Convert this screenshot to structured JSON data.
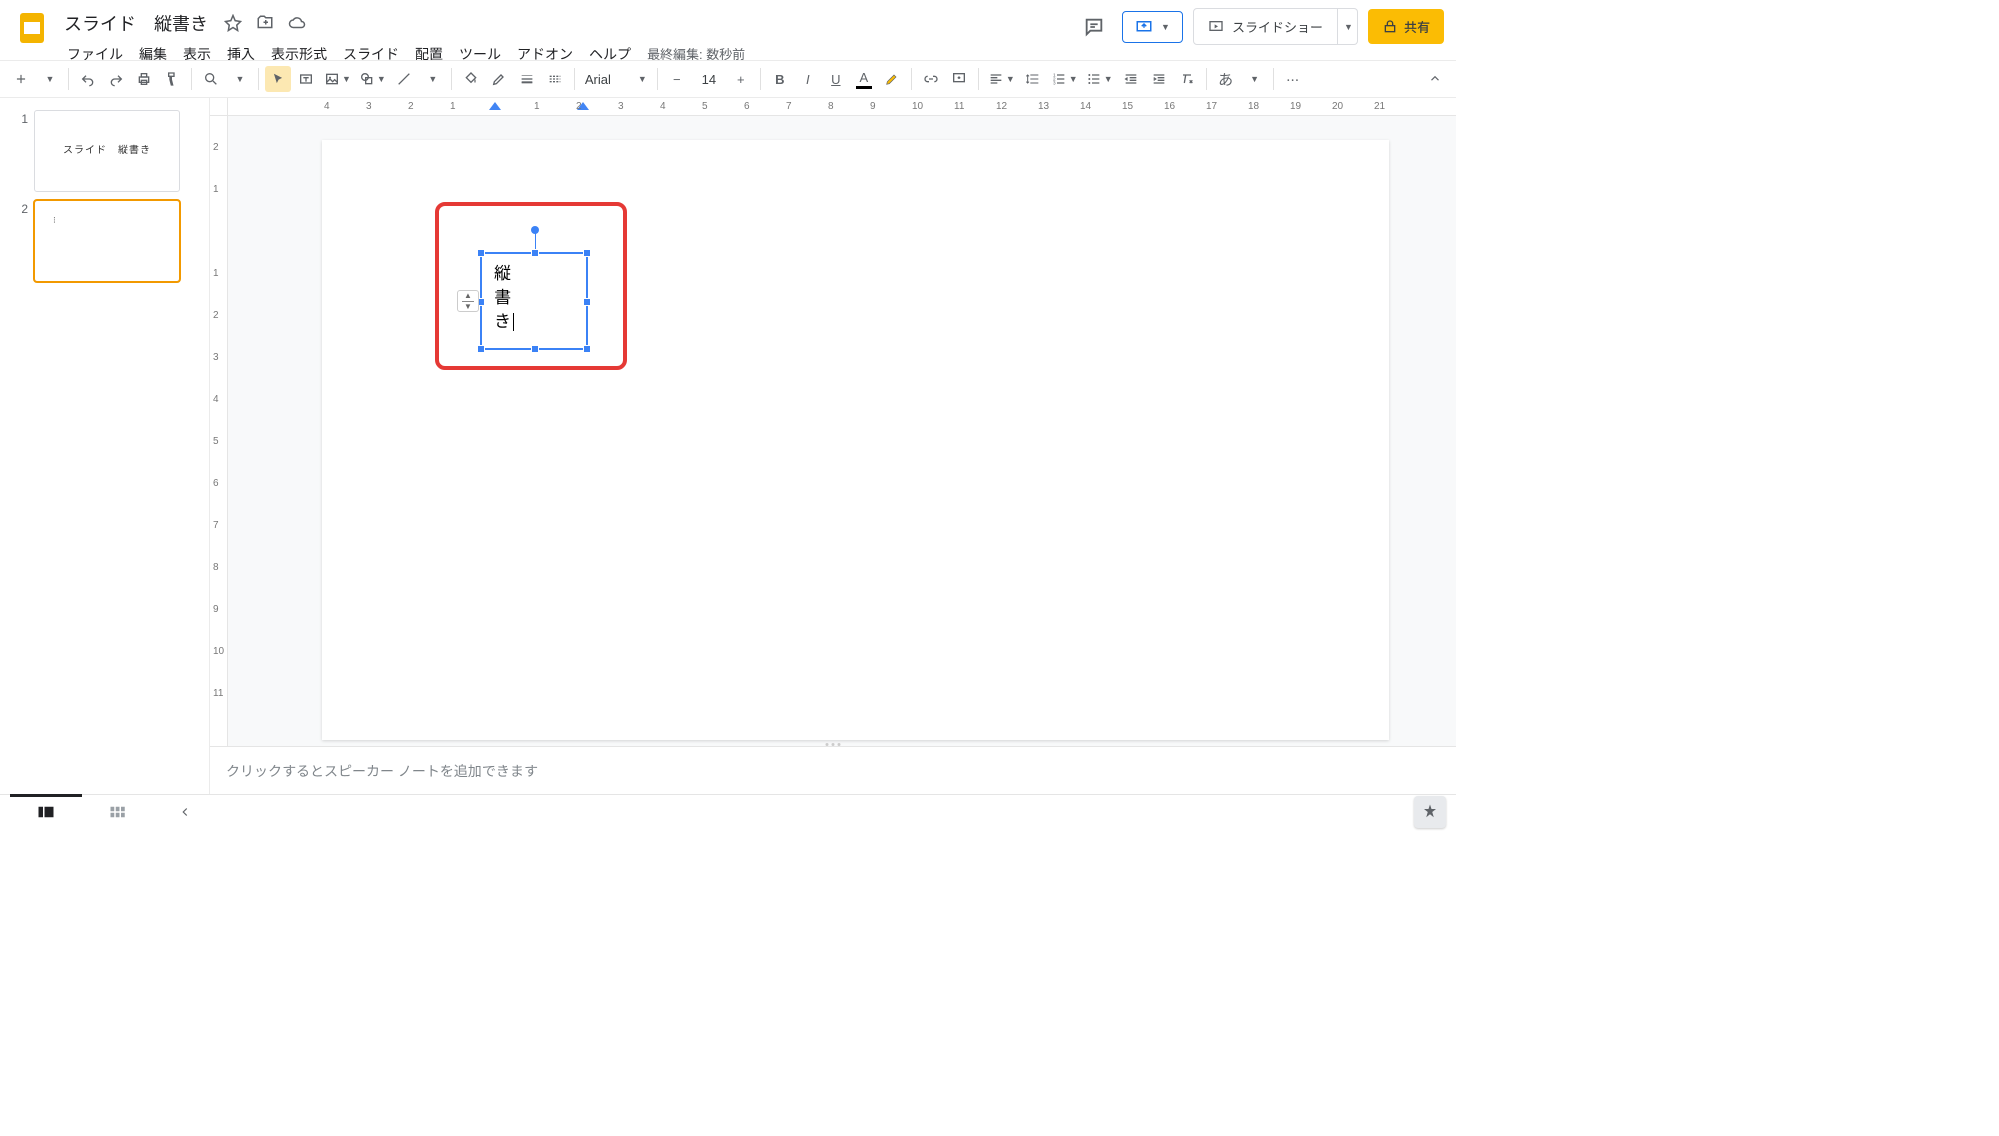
{
  "doc": {
    "title": "スライド　縦書き",
    "last_edit": "最終編集: 数秒前"
  },
  "menu": {
    "file": "ファイル",
    "edit": "編集",
    "view": "表示",
    "insert": "挿入",
    "format": "表示形式",
    "slide": "スライド",
    "arrange": "配置",
    "tools": "ツール",
    "addons": "アドオン",
    "help": "ヘルプ"
  },
  "actions": {
    "slideshow": "スライドショー",
    "share": "共有"
  },
  "toolbar": {
    "font": "Arial",
    "font_size": "14",
    "ime": "あ"
  },
  "filmstrip": {
    "s1_num": "1",
    "s1_text": "スライド　縦書き",
    "s2_num": "2"
  },
  "canvas": {
    "text_l1": "縦",
    "text_l2": "書",
    "text_l3": "き"
  },
  "hruler_ticks": [
    "4",
    "3",
    "2",
    "1",
    "",
    "1",
    "2",
    "3",
    "4",
    "5",
    "6",
    "7",
    "8",
    "9",
    "10",
    "11",
    "12",
    "13",
    "14",
    "15",
    "16",
    "17",
    "18",
    "19",
    "20",
    "21"
  ],
  "vruler_ticks": [
    "2",
    "1",
    "",
    "1",
    "2",
    "3",
    "4",
    "5",
    "6",
    "7",
    "8",
    "9",
    "10",
    "11"
  ],
  "speaker_notes": {
    "placeholder": "クリックするとスピーカー ノートを追加できます"
  }
}
